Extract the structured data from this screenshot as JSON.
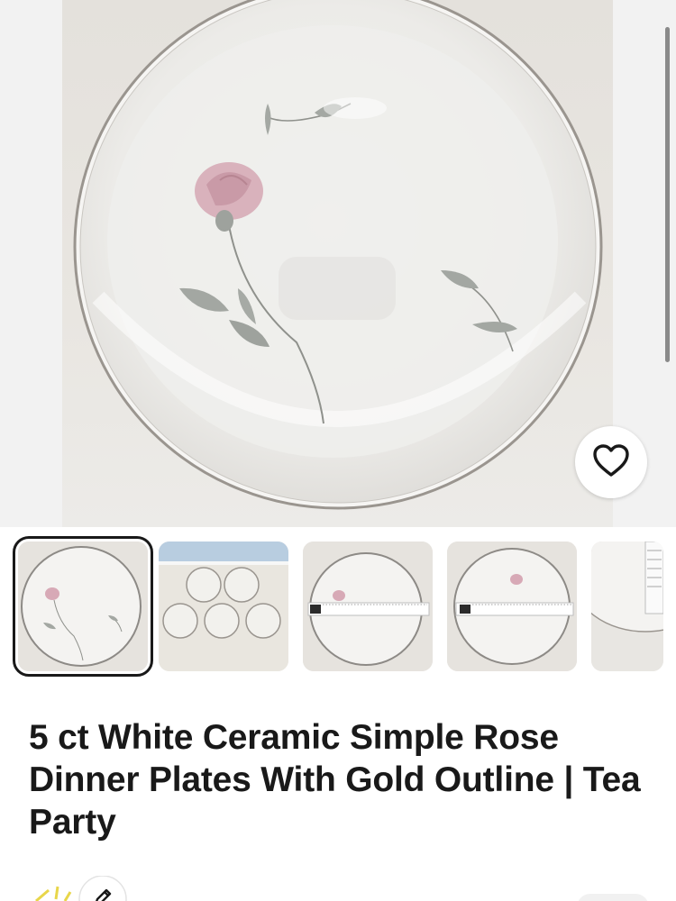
{
  "listing": {
    "title": "5 ct White Ceramic Simple Rose Dinner Plates With Gold Outline | Tea Party"
  },
  "gallery": {
    "selected_index": 0,
    "thumbnail_count_visible": 5
  },
  "icons": {
    "favorite": "heart-outline-icon",
    "edit": "pencil-icon"
  },
  "colors": {
    "text_primary": "#191919",
    "selected_outline": "#191919",
    "plate_rim": "#8d8a86",
    "rose": "#d9a9b6",
    "leaf": "#9aa19a"
  }
}
